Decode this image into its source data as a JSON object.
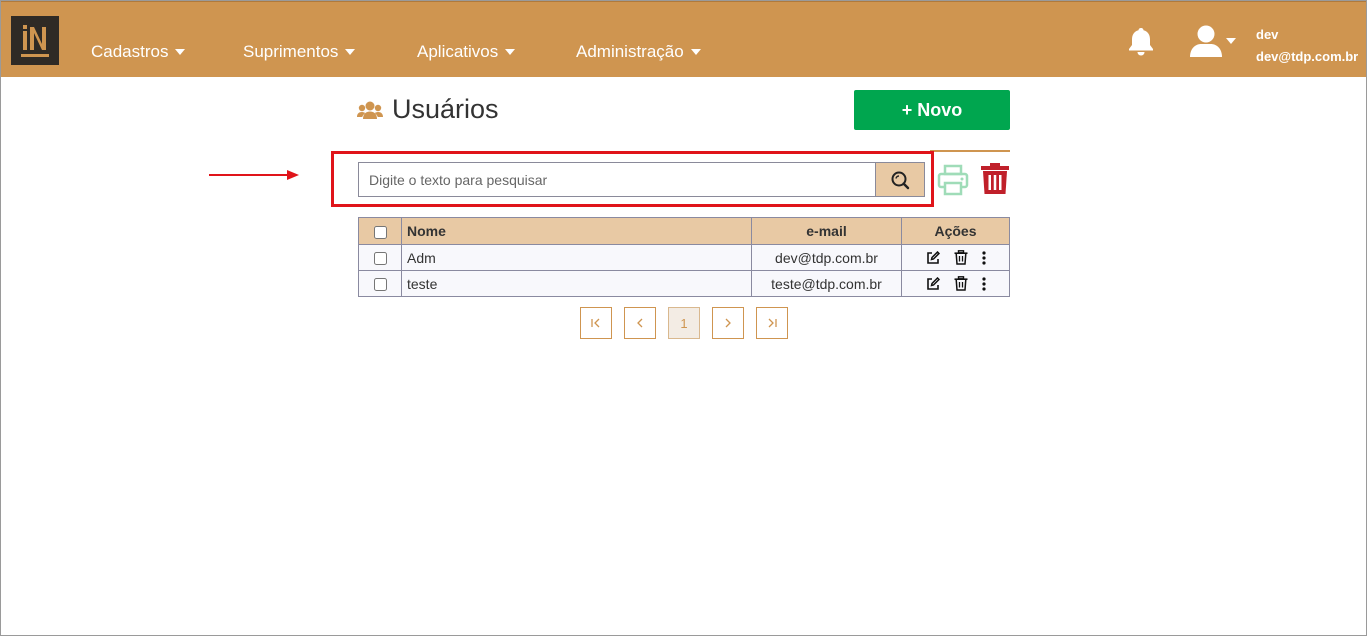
{
  "navbar": {
    "menu": [
      {
        "label": "Cadastros"
      },
      {
        "label": "Suprimentos"
      },
      {
        "label": "Aplicativos"
      },
      {
        "label": "Administração"
      }
    ],
    "user": {
      "name": "dev",
      "email": "dev@tdp.com.br"
    }
  },
  "page": {
    "title": "Usuários",
    "new_button_label": "+ Novo"
  },
  "search": {
    "placeholder": "Digite o texto para pesquisar",
    "value": ""
  },
  "table": {
    "headers": {
      "name": "Nome",
      "email": "e-mail",
      "actions": "Ações"
    },
    "rows": [
      {
        "name": "Adm",
        "email": "dev@tdp.com.br"
      },
      {
        "name": "teste",
        "email": "teste@tdp.com.br"
      }
    ]
  },
  "pagination": {
    "current_page": "1"
  },
  "colors": {
    "navbar": "#cf9550",
    "new_button": "#00a64f",
    "delete_icon": "#c0202a",
    "print_icon": "#9fdcb8",
    "highlight": "#e0141a"
  }
}
